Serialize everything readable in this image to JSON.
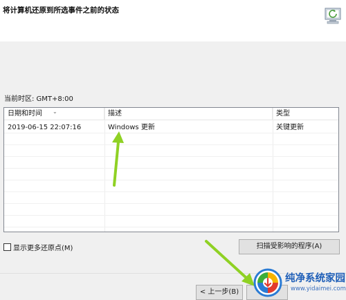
{
  "dialog": {
    "title": "将计算机还原到所选事件之前的状态",
    "timezone": "当前时区: GMT+8:00"
  },
  "table": {
    "columns": [
      "日期和时间",
      "描述",
      "类型"
    ],
    "rows": [
      {
        "datetime": "2019-06-15 22:07:16",
        "description": "Windows 更新",
        "type": "关键更新"
      }
    ]
  },
  "options": {
    "show_more_label": "显示更多还原点(M)",
    "show_more_checked": false
  },
  "buttons": {
    "scan": "扫描受影响的程序(A)",
    "back": "< 上一步(B)",
    "next": ""
  },
  "watermark": {
    "title": "纯净系统家园",
    "url": "www.yidaimei.com"
  },
  "colors": {
    "annotation_arrow": "#8fd124",
    "watermark_text": "#1f5fb8"
  }
}
